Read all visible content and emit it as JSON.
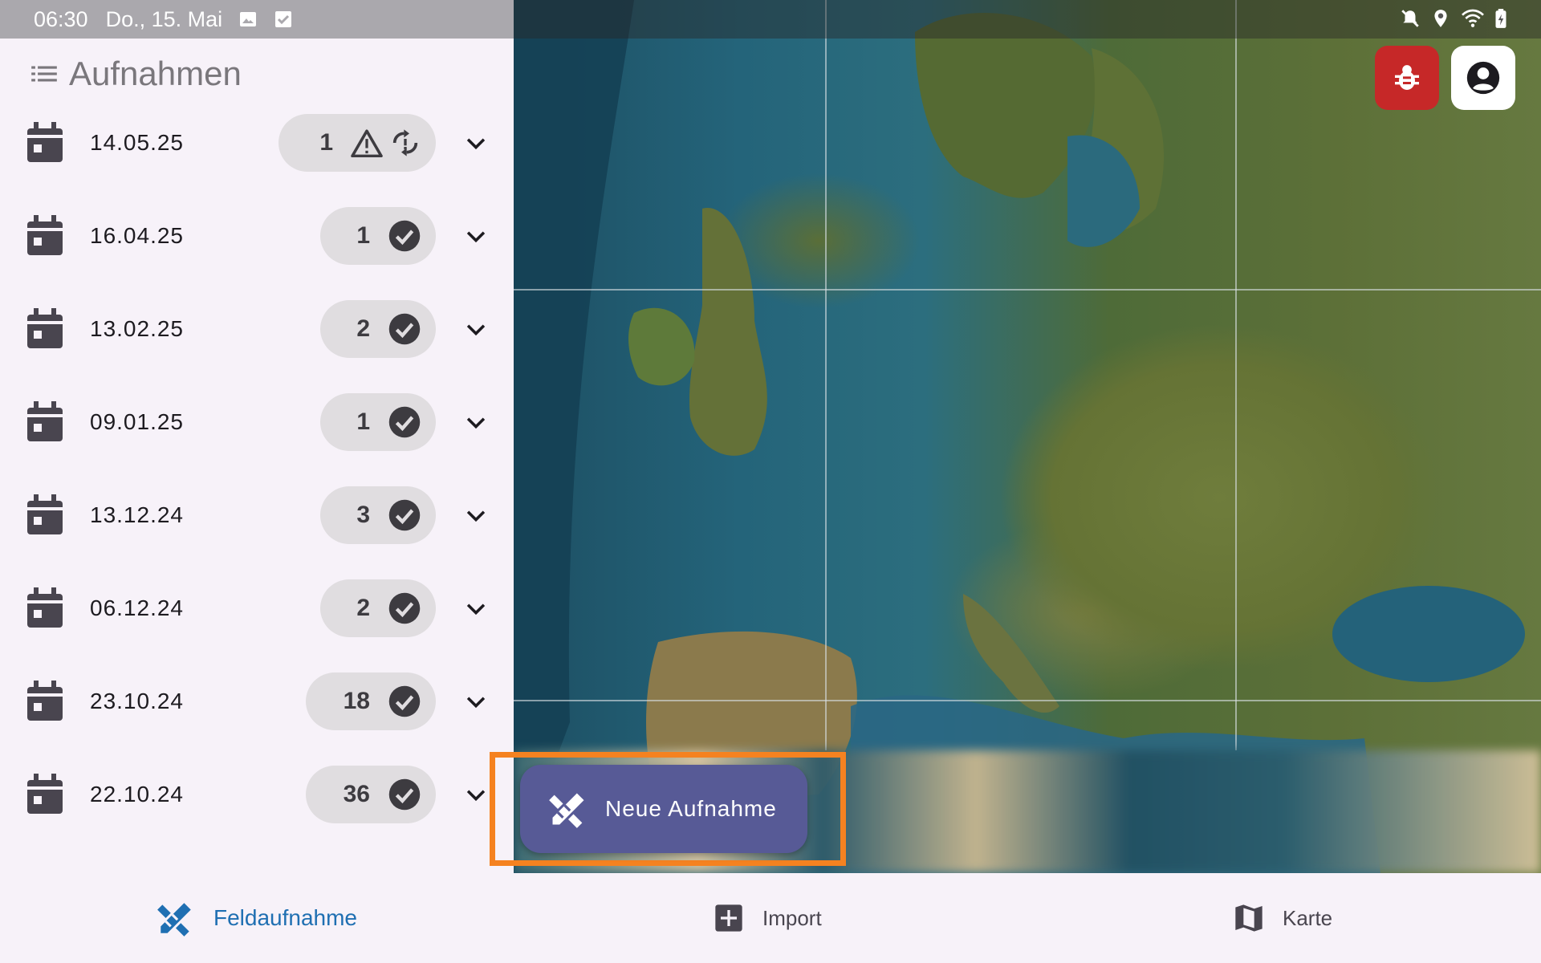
{
  "status_bar": {
    "time": "06:30",
    "date": "Do., 15. Mai",
    "left_icons": [
      "image-icon",
      "checkbox-icon"
    ],
    "right_icons": [
      "mute-icon",
      "location-icon",
      "wifi-icon",
      "battery-icon"
    ]
  },
  "sidebar": {
    "title": "Aufnahmen",
    "rows": [
      {
        "date": "14.05.25",
        "count": "1",
        "status": "warning-sync"
      },
      {
        "date": "16.04.25",
        "count": "1",
        "status": "done"
      },
      {
        "date": "13.02.25",
        "count": "2",
        "status": "done"
      },
      {
        "date": "09.01.25",
        "count": "1",
        "status": "done"
      },
      {
        "date": "13.12.24",
        "count": "3",
        "status": "done"
      },
      {
        "date": "06.12.24",
        "count": "2",
        "status": "done"
      },
      {
        "date": "23.10.24",
        "count": "18",
        "status": "done"
      },
      {
        "date": "22.10.24",
        "count": "36",
        "status": "done"
      }
    ]
  },
  "fab": {
    "label": "Neue Aufnahme"
  },
  "bottom_nav": {
    "items": [
      {
        "label": "Feldaufnahme",
        "icon": "pencil-ruler-icon",
        "active": true
      },
      {
        "label": "Import",
        "icon": "plus-box-icon",
        "active": false
      },
      {
        "label": "Karte",
        "icon": "map-icon",
        "active": false
      }
    ]
  },
  "colors": {
    "accent": "#1f6fb2",
    "fab": "#575a96",
    "highlight": "#f58220",
    "bug_button": "#c62828"
  }
}
